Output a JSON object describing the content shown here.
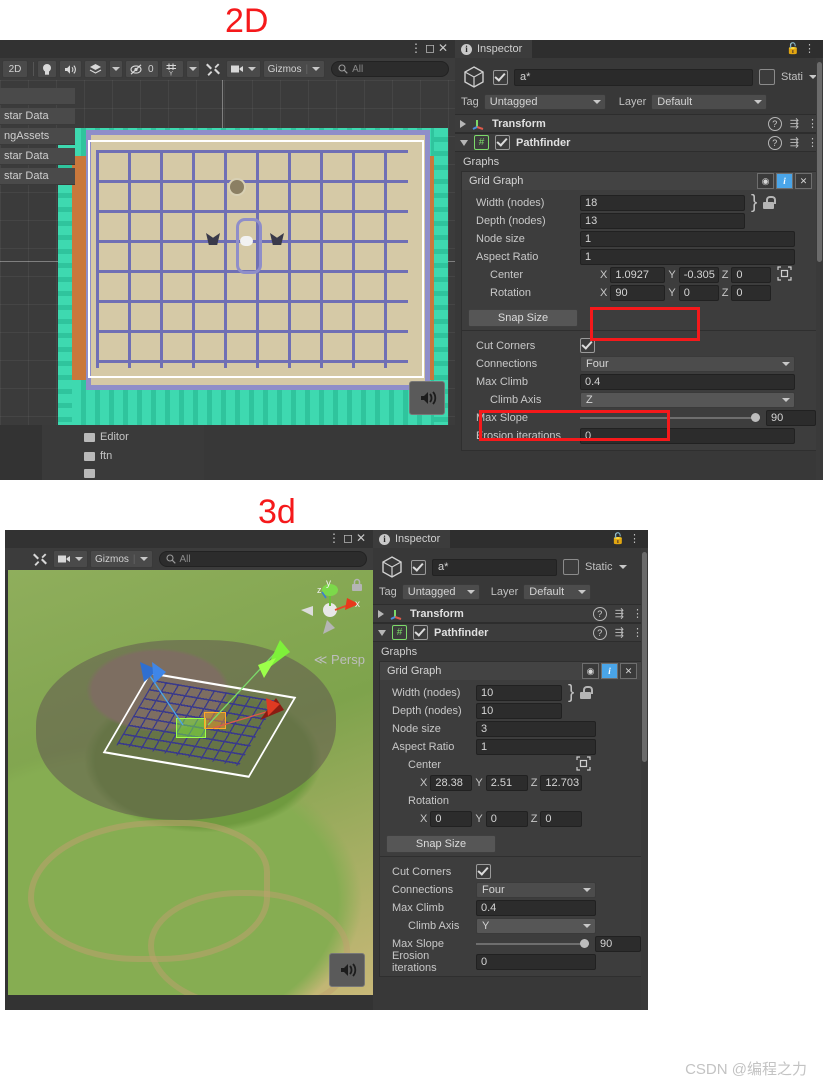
{
  "captions": {
    "two_d": "2D",
    "three_d": "3d"
  },
  "watermark": "CSDN @编程之力",
  "scene_2d": {
    "window_controls": {
      "menu": "⋮",
      "maximize": "◻",
      "close": "✕"
    },
    "toolbar": {
      "mode_2d": "2D",
      "lighting_icon": "lightbulb-icon",
      "audio_icon": "speaker-icon",
      "fx_icon": "layers-icon",
      "fx_caret": "▾",
      "visibility_icon": "eye-off-icon",
      "visibility_count": "0",
      "grid_icon": "grid-y-icon",
      "grid_caret": "▾",
      "tools_icon": "wrench-icon",
      "camera_icon": "camera-icon",
      "camera_caret": "▾",
      "gizmos_label": "Gizmos",
      "gizmos_caret": "▾",
      "search_placeholder": "All",
      "search_value": ""
    },
    "hierarchy_peek": [
      "star Data",
      "ngAssets",
      "star Data",
      "star Data"
    ],
    "project_peek": [
      "Editor",
      "ftn"
    ]
  },
  "scene_3d": {
    "window_controls": {
      "menu": "⋮",
      "maximize": "◻",
      "close": "✕"
    },
    "toolbar": {
      "tools_icon": "wrench-icon",
      "camera_icon": "camera-icon",
      "camera_caret": "▾",
      "gizmos_label": "Gizmos",
      "gizmos_caret": "▾",
      "search_placeholder": "All",
      "search_value": ""
    },
    "viewport": {
      "projection_label": "Persp",
      "projection_prefix": "≪",
      "axis_x": "x",
      "axis_y": "y",
      "axis_z": "z",
      "lock_icon": "lock-icon",
      "audio_icon": "audio-listener-icon"
    }
  },
  "inspector_2d": {
    "tab_label": "Inspector",
    "tab_icon": "info-icon",
    "lock_icon": "lock-icon",
    "menu_icon": "kebab-menu-icon",
    "object": {
      "enabled": true,
      "name": "a*",
      "static_label": "Stati",
      "static_checked": false,
      "tag_label": "Tag",
      "tag_value": "Untagged",
      "layer_label": "Layer",
      "layer_value": "Default"
    },
    "components": [
      {
        "name": "Transform",
        "expanded": false,
        "enabled_checkbox": false
      },
      {
        "name": "Pathfinder",
        "expanded": true,
        "enabled_checkbox": true,
        "enabled": true
      }
    ],
    "graphs_label": "Graphs",
    "grid_graph": {
      "title": "Grid Graph",
      "icons": {
        "eye": "eye-icon",
        "info": "info-icon",
        "close": "close-icon"
      },
      "width_label": "Width (nodes)",
      "width_value": "18",
      "depth_label": "Depth (nodes)",
      "depth_value": "13",
      "node_size_label": "Node size",
      "node_size_value": "1",
      "aspect_label": "Aspect Ratio",
      "aspect_value": "1",
      "center_label": "Center",
      "center": {
        "x": "1.0927",
        "y": "-0.305",
        "z": "0"
      },
      "rotation_label": "Rotation",
      "rotation": {
        "x": "90",
        "y": "0",
        "z": "0"
      },
      "snap_size_label": "Snap Size",
      "cut_corners_label": "Cut Corners",
      "cut_corners_checked": true,
      "connections_label": "Connections",
      "connections_value": "Four",
      "max_climb_label": "Max Climb",
      "max_climb_value": "0.4",
      "climb_axis_label": "Climb Axis",
      "climb_axis_value": "Z",
      "max_slope_label": "Max Slope",
      "max_slope_value": "90",
      "erosion_label": "Erosion iterations",
      "erosion_value": "0",
      "axis_x": "X",
      "axis_y": "Y",
      "axis_z": "Z"
    },
    "highlights": {
      "rotation_x": "#f5191b",
      "climb_axis": "#f5191b"
    }
  },
  "inspector_3d": {
    "tab_label": "Inspector",
    "tab_icon": "info-icon",
    "lock_icon": "lock-icon",
    "menu_icon": "kebab-menu-icon",
    "object": {
      "enabled": true,
      "name": "a*",
      "static_label": "Static",
      "static_checked": false,
      "tag_label": "Tag",
      "tag_value": "Untagged",
      "layer_label": "Layer",
      "layer_value": "Default"
    },
    "components": [
      {
        "name": "Transform",
        "expanded": false
      },
      {
        "name": "Pathfinder",
        "expanded": true,
        "enabled": true
      }
    ],
    "graphs_label": "Graphs",
    "grid_graph": {
      "title": "Grid Graph",
      "width_label": "Width (nodes)",
      "width_value": "10",
      "depth_label": "Depth (nodes)",
      "depth_value": "10",
      "node_size_label": "Node size",
      "node_size_value": "3",
      "aspect_label": "Aspect Ratio",
      "aspect_value": "1",
      "center_label": "Center",
      "center": {
        "x": "28.38",
        "y": "2.51",
        "z": "12.703"
      },
      "rotation_label": "Rotation",
      "rotation": {
        "x": "0",
        "y": "0",
        "z": "0"
      },
      "snap_size_label": "Snap Size",
      "cut_corners_label": "Cut Corners",
      "cut_corners_checked": true,
      "connections_label": "Connections",
      "connections_value": "Four",
      "max_climb_label": "Max Climb",
      "max_climb_value": "0.4",
      "climb_axis_label": "Climb Axis",
      "climb_axis_value": "Y",
      "max_slope_label": "Max Slope",
      "max_slope_value": "90",
      "erosion_label": "Erosion iterations",
      "erosion_value": "0",
      "axis_x": "X",
      "axis_y": "Y",
      "axis_z": "Z"
    }
  },
  "colors": {
    "accent_red": "#f5191b",
    "panel_bg": "#383838",
    "field_bg": "#2c2c2c",
    "blue_icon": "#4aa5e8"
  }
}
